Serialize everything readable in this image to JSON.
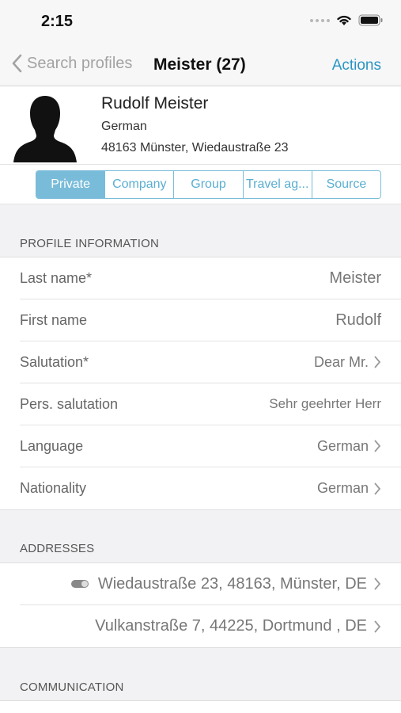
{
  "status": {
    "time": "2:15"
  },
  "nav": {
    "back_label": "Search profiles",
    "title": "Meister (27)",
    "actions_label": "Actions"
  },
  "profile": {
    "name": "Rudolf Meister",
    "nationality": "German",
    "address": "48163 Münster, Wiedaustraße 23"
  },
  "tabs": [
    {
      "label": "Private",
      "active": true
    },
    {
      "label": "Company",
      "active": false
    },
    {
      "label": "Group",
      "active": false
    },
    {
      "label": "Travel ag...",
      "active": false
    },
    {
      "label": "Source",
      "active": false
    }
  ],
  "sections": {
    "profile_information": "PROFILE INFORMATION",
    "addresses": "ADDRESSES",
    "communication": "COMMUNICATION"
  },
  "profile_fields": [
    {
      "label": "Last name*",
      "value": "Meister"
    },
    {
      "label": "First name",
      "value": "Rudolf"
    },
    {
      "label": "Salutation*",
      "value": "Dear Mr."
    },
    {
      "label": "Pers. salutation",
      "value": "Sehr geehrter Herr"
    },
    {
      "label": "Language",
      "value": "German"
    },
    {
      "label": "Nationality",
      "value": "German"
    }
  ],
  "addresses": [
    {
      "value": "Wiedaustraße 23, 48163, Münster, DE",
      "primary": true
    },
    {
      "value": "Vulkanstraße 7, 44225, Dortmund , DE",
      "primary": false
    }
  ],
  "icons": {
    "back": "chevron-left-icon",
    "wifi": "wifi-icon",
    "battery": "battery-icon",
    "avatar": "person-silhouette-icon",
    "disclosure": "chevron-right-icon",
    "primary_address": "toggle-icon"
  },
  "colors": {
    "accent": "#2a96c4",
    "segment": "#79bcd9",
    "background": "#f2f2f4"
  }
}
